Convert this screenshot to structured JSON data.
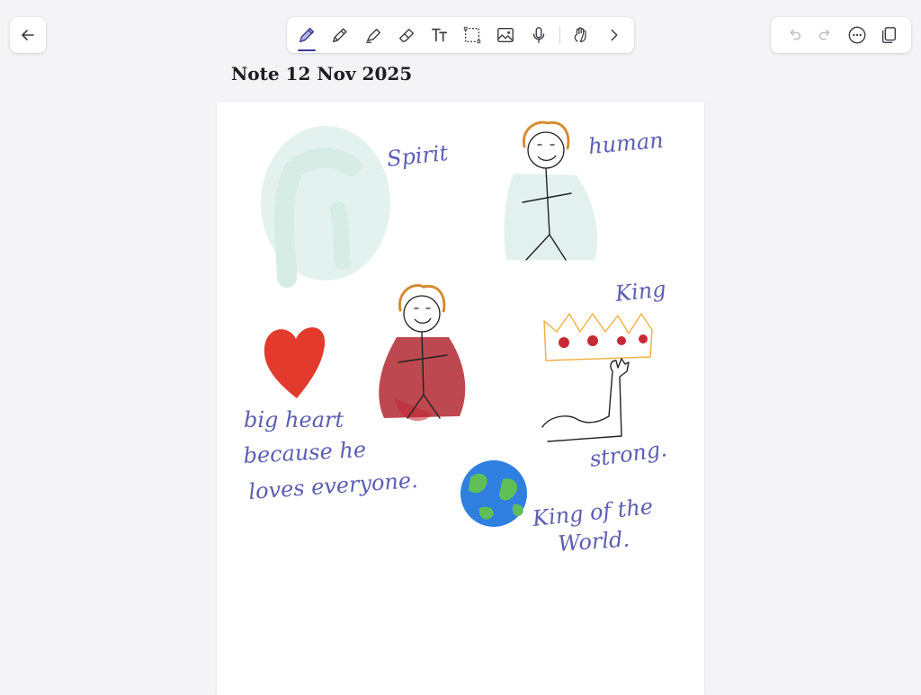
{
  "note": {
    "title": "Note 12 Nov 2025"
  },
  "toolbar": {
    "tools": [
      {
        "name": "pen-tool",
        "icon": "pen-icon",
        "active": true
      },
      {
        "name": "pencil-tool",
        "icon": "pencil-icon",
        "active": false
      },
      {
        "name": "highlighter-tool",
        "icon": "highlighter-icon",
        "active": false
      },
      {
        "name": "eraser-tool",
        "icon": "eraser-icon",
        "active": false
      },
      {
        "name": "text-tool",
        "icon": "text-icon",
        "active": false
      },
      {
        "name": "lasso-tool",
        "icon": "selection-icon",
        "active": false
      },
      {
        "name": "image-tool",
        "icon": "image-icon",
        "active": false
      },
      {
        "name": "audio-tool",
        "icon": "microphone-icon",
        "active": false
      },
      {
        "name": "touch-tool",
        "icon": "hand-icon",
        "active": false
      }
    ],
    "accent": "#3b3d8f"
  },
  "drawing": {
    "labels": {
      "spirit": "Spirit",
      "human": "human",
      "king": "King",
      "big_heart_1": "big heart",
      "big_heart_2": "because he",
      "big_heart_3": "loves everyone.",
      "strong": "strong.",
      "world_1": "King of the",
      "world_2": "World."
    },
    "ink_color": "#5b5eb3"
  }
}
